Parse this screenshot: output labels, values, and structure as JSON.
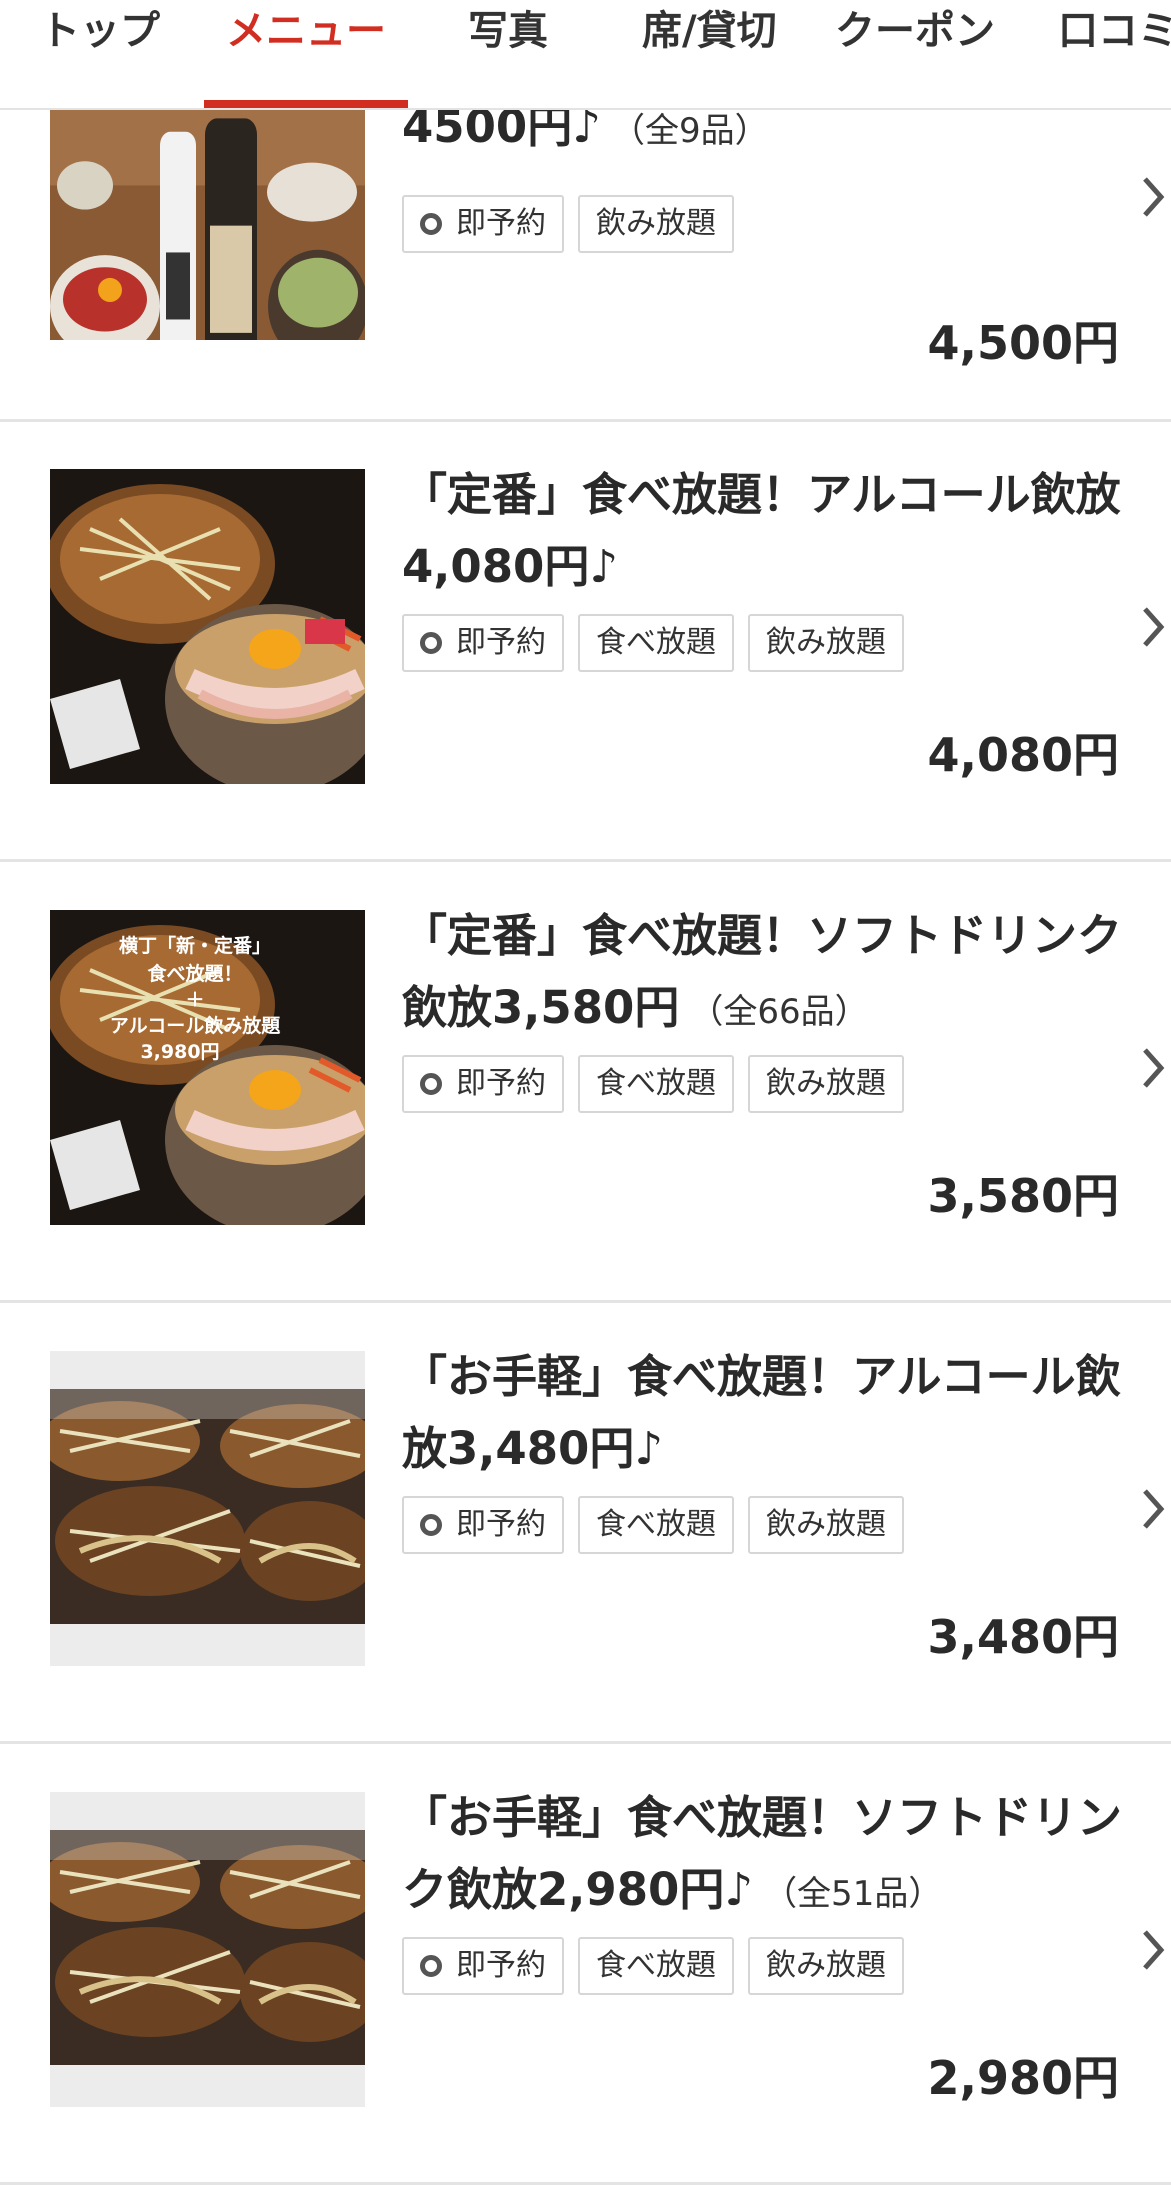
{
  "tabs": [
    {
      "label": "トップ",
      "active": false
    },
    {
      "label": "メニュー",
      "active": true
    },
    {
      "label": "写真",
      "active": false
    },
    {
      "label": "席/貸切",
      "active": false
    },
    {
      "label": "クーポン",
      "active": false
    },
    {
      "label": "口コミ",
      "active": false
    }
  ],
  "colors": {
    "accent": "#d22d21",
    "border": "#e4e4e4"
  },
  "items": [
    {
      "title": "4500円♪",
      "count": "（全9品）",
      "tags": [
        "即予約",
        "飲み放題"
      ],
      "price": "4,500円",
      "image": "dishes-and-sake-bottles-photo"
    },
    {
      "title": "「定番」食べ放題！アルコール飲放4,080円♪",
      "count": "",
      "tags": [
        "即予約",
        "食べ放題",
        "飲み放題"
      ],
      "price": "4,080円",
      "image": "okonomiyaki-and-pork-egg-bowl-photo"
    },
    {
      "title": "「定番」食べ放題！ソフトドリンク飲放3,580円",
      "count": "（全66品）",
      "tags": [
        "即予約",
        "食べ放題",
        "飲み放題"
      ],
      "price": "3,580円",
      "image": "okonomiyaki-and-pork-egg-bowl-photo",
      "image_text": [
        "横丁「新・定番」",
        "食べ放題！",
        "＋",
        "アルコール飲み放題",
        "3,980円"
      ]
    },
    {
      "title": "「お手軽」食べ放題！アルコール飲放3,480円♪",
      "count": "",
      "tags": [
        "即予約",
        "食べ放題",
        "飲み放題"
      ],
      "price": "3,480円",
      "image": "okonomiyaki-on-griddle-photo"
    },
    {
      "title": "「お手軽」食べ放題！ソフトドリンク飲放2,980円♪",
      "count": "（全51品）",
      "tags": [
        "即予約",
        "食べ放題",
        "飲み放題"
      ],
      "price": "2,980円",
      "image": "okonomiyaki-on-griddle-photo"
    }
  ]
}
